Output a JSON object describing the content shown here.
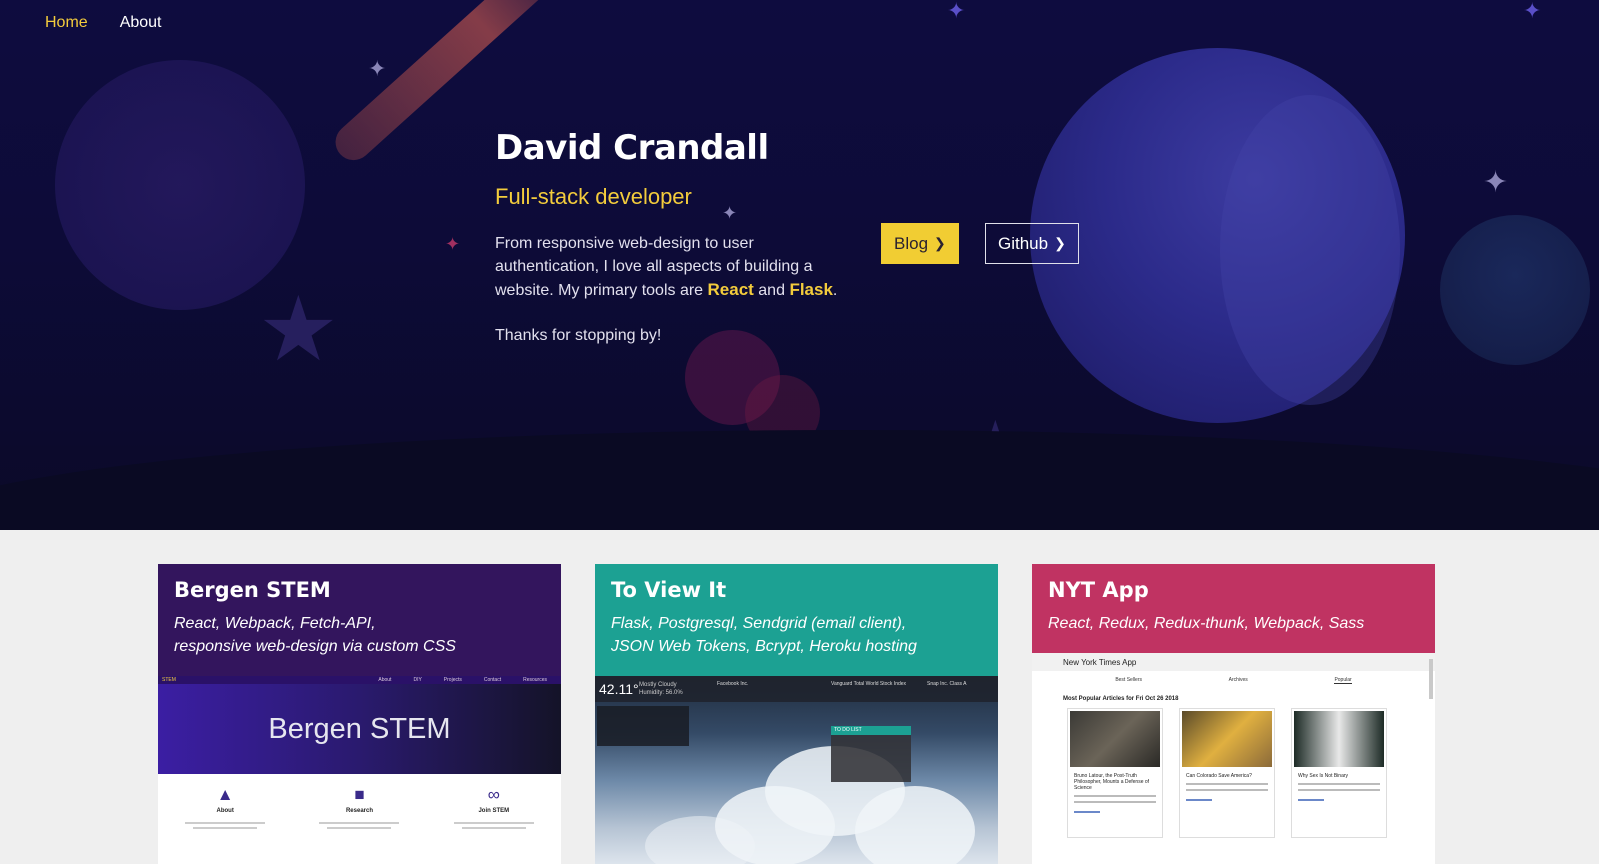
{
  "nav": {
    "home_label": "Home",
    "about_label": "About"
  },
  "hero": {
    "name": "David Crandall",
    "role": "Full-stack developer",
    "intro_text": "From responsive web-design to user authentication, I love all aspects of building a website. My primary tools are",
    "tool_1": "React",
    "and_word": "and",
    "tool_2": "Flask",
    "period": ".",
    "thanks": "Thanks for stopping by!",
    "blog_label": "Blog",
    "github_label": "Github"
  },
  "projects": [
    {
      "title": "Bergen STEM",
      "tech_line1": "React, Webpack, Fetch-API,",
      "tech_line2": "responsive web-design via custom CSS",
      "color": "#33155d",
      "preview": {
        "logo": "STEM",
        "menu": [
          "About",
          "DIY",
          "Projects",
          "Contact",
          "Resources"
        ],
        "banner_title": "Bergen STEM",
        "features": [
          "About",
          "Research",
          "Join STEM"
        ]
      }
    },
    {
      "title": "To View It",
      "tech_line1": "Flask, Postgresql, Sendgrid (email client),",
      "tech_line2": "JSON Web Tokens, Bcrypt, Heroku hosting",
      "color": "#1ca193",
      "preview": {
        "temperature": "42.11°",
        "weather": "Mostly Cloudy",
        "humidity": "Humidity: 56.0%",
        "tickers": [
          "Facebook Inc.",
          "Vanguard Total World Stock Index",
          "Snap Inc. Class A"
        ],
        "todo_title": "TO DO LIST"
      }
    },
    {
      "title": "NYT App",
      "tech_line1": "React, Redux, Redux-thunk, Webpack, Sass",
      "tech_line2": "",
      "color": "#c03362",
      "preview": {
        "app_title": "New York Times App",
        "tabs": [
          "Best Sellers",
          "Archives",
          "Popular"
        ],
        "heading": "Most Popular Articles for Fri Oct 26 2018",
        "articles": [
          "Bruno Latour, the Post-Truth Philosopher, Mounts a Defense of Science",
          "Can Colorado Save America?",
          "Why Sex Is Not Binary"
        ]
      }
    }
  ],
  "colors": {
    "accent": "#f3cc3c",
    "hero_bg": "#0e0c3f"
  }
}
